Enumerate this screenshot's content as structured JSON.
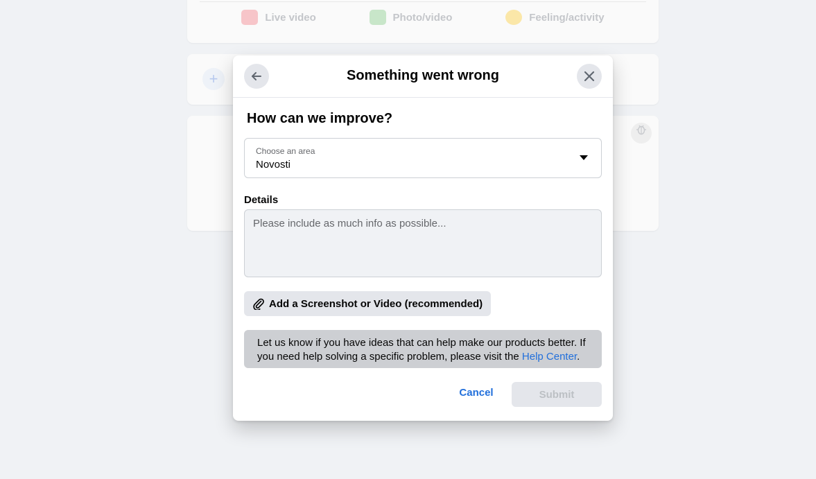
{
  "background": {
    "composer_actions": [
      {
        "label": "Live video",
        "icon": "live-video-icon"
      },
      {
        "label": "Photo/video",
        "icon": "photo-video-icon"
      },
      {
        "label": "Feeling/activity",
        "icon": "feeling-icon"
      }
    ],
    "story_add": "+"
  },
  "dialog": {
    "title": "Something went wrong",
    "heading": "How can we improve?",
    "area": {
      "label": "Choose an area",
      "value": "Novosti"
    },
    "details": {
      "label": "Details",
      "placeholder": "Please include as much info as possible..."
    },
    "attach_label": "Add a Screenshot or Video (recommended)",
    "info": {
      "text": "Let us know if you have ideas that can help make our products better. If you need help solving a specific problem, please visit the ",
      "link": "Help Center",
      "suffix": "."
    },
    "cancel_label": "Cancel",
    "submit_label": "Submit"
  },
  "colors": {
    "link": "#216fdb",
    "button_bg": "#e4e6eb",
    "info_bg": "#cdcfd3"
  }
}
